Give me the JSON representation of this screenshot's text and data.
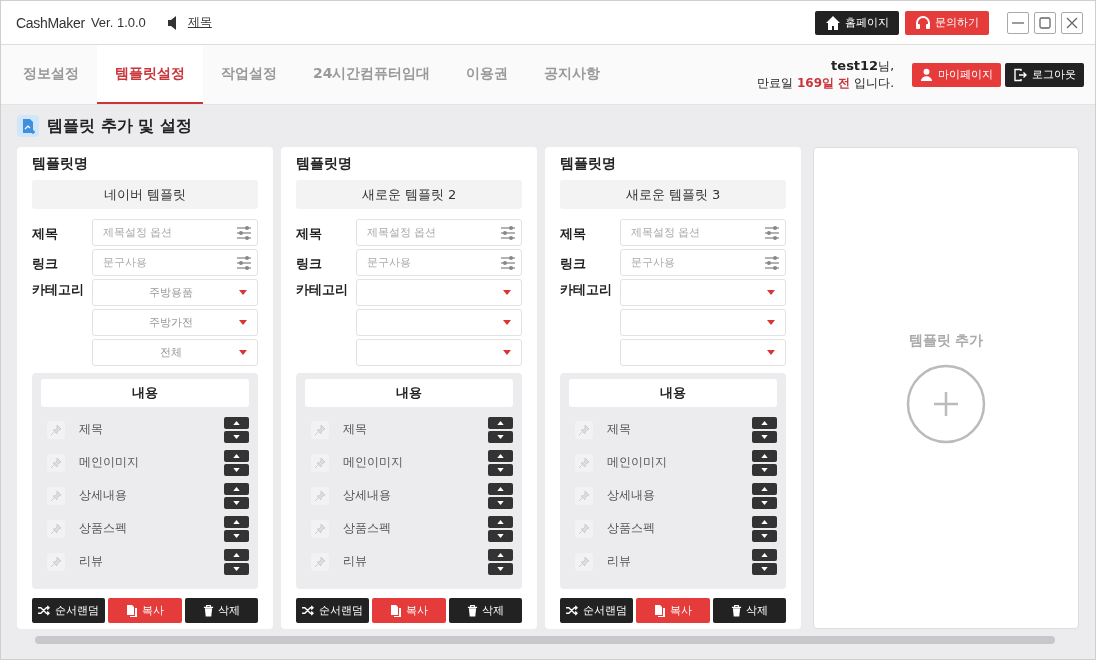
{
  "app": {
    "brand": "CashMaker",
    "version": "Ver. 1.0.0",
    "notice": "제목"
  },
  "header_buttons": [
    {
      "label": "홈페이지",
      "kind": "home"
    },
    {
      "label": "문의하기",
      "kind": "support"
    }
  ],
  "tabs": [
    {
      "label": "정보설정",
      "selected": false
    },
    {
      "label": "템플릿설정",
      "selected": true
    },
    {
      "label": "작업설정",
      "selected": false
    },
    {
      "label": "24시간컴퓨터임대",
      "selected": false
    },
    {
      "label": "이용권",
      "selected": false
    },
    {
      "label": "공지사항",
      "selected": false
    }
  ],
  "user": {
    "name": "test12",
    "suffix": "님,",
    "expiry_prefix": "만료일",
    "expiry_highlight": "169일 전",
    "expiry_suffix": "입니다."
  },
  "user_buttons": [
    {
      "label": "마이페이지",
      "kind": "mypage"
    },
    {
      "label": "로그아웃",
      "kind": "logout"
    }
  ],
  "section_title": "템플릿 추가 및 설정",
  "templates": [
    {
      "name_label": "템플릿명",
      "name": "네이버 템플릿",
      "title_label": "제목",
      "title_placeholder": "제목설정 옵션",
      "link_label": "링크",
      "link_placeholder": "문구사용",
      "category_label": "카테고리",
      "categories": [
        {
          "kind": "select",
          "value": "주방용품"
        },
        {
          "kind": "select",
          "value": "주방가전"
        },
        {
          "kind": "select",
          "value": "전체"
        }
      ],
      "content_title": "내용",
      "content_items": [
        "제목",
        "메인이미지",
        "상세내용",
        "상품스펙",
        "리뷰"
      ],
      "actions": [
        {
          "label": "순서랜덤",
          "kind": "shuffle"
        },
        {
          "label": "복사",
          "kind": "copy"
        },
        {
          "label": "삭제",
          "kind": "delete"
        }
      ]
    },
    {
      "name_label": "템플릿명",
      "name": "새로운 템플릿 2",
      "title_label": "제목",
      "title_placeholder": "제목설정 옵션",
      "link_label": "링크",
      "link_placeholder": "문구사용",
      "category_label": "카테고리",
      "categories": [
        {
          "kind": "select"
        },
        {
          "kind": "select"
        },
        {
          "kind": "select"
        }
      ],
      "content_title": "내용",
      "content_items": [
        "제목",
        "메인이미지",
        "상세내용",
        "상품스펙",
        "리뷰"
      ],
      "actions": [
        {
          "label": "순서랜덤",
          "kind": "shuffle"
        },
        {
          "label": "복사",
          "kind": "copy"
        },
        {
          "label": "삭제",
          "kind": "delete"
        }
      ]
    },
    {
      "name_label": "템플릿명",
      "name": "새로운 템플릿 3",
      "title_label": "제목",
      "title_placeholder": "제목설정 옵션",
      "link_label": "링크",
      "link_placeholder": "문구사용",
      "category_label": "카테고리",
      "categories": [
        {
          "kind": "select"
        },
        {
          "kind": "select"
        },
        {
          "kind": "select"
        }
      ],
      "content_title": "내용",
      "content_items": [
        "제목",
        "메인이미지",
        "상세내용",
        "상품스펙",
        "리뷰"
      ],
      "actions": [
        {
          "label": "순서랜덤",
          "kind": "shuffle"
        },
        {
          "label": "복사",
          "kind": "copy"
        },
        {
          "label": "삭제",
          "kind": "delete"
        }
      ]
    }
  ],
  "add_template": {
    "label": "템플릿 추가"
  }
}
